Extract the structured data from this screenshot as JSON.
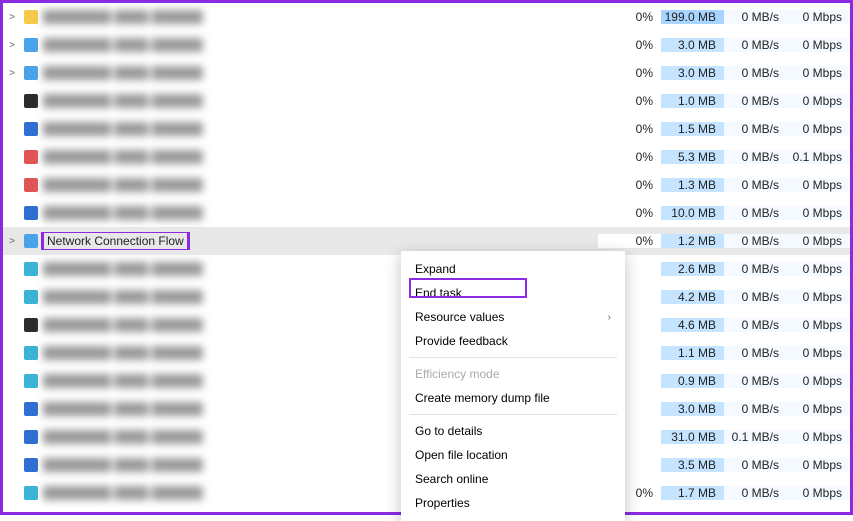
{
  "selected_process_name": "Network Connection Flow",
  "rows": [
    {
      "expand": ">",
      "icon": "yellow",
      "cpu": "0%",
      "mem": "199.0 MB",
      "disk": "0 MB/s",
      "net": "0 Mbps",
      "hot": true
    },
    {
      "expand": ">",
      "icon": "blue",
      "cpu": "0%",
      "mem": "3.0 MB",
      "disk": "0 MB/s",
      "net": "0 Mbps"
    },
    {
      "expand": ">",
      "icon": "blue",
      "cpu": "0%",
      "mem": "3.0 MB",
      "disk": "0 MB/s",
      "net": "0 Mbps"
    },
    {
      "expand": "",
      "icon": "dark",
      "cpu": "0%",
      "mem": "1.0 MB",
      "disk": "0 MB/s",
      "net": "0 Mbps"
    },
    {
      "expand": "",
      "icon": "wblue",
      "cpu": "0%",
      "mem": "1.5 MB",
      "disk": "0 MB/s",
      "net": "0 Mbps"
    },
    {
      "expand": "",
      "icon": "red",
      "cpu": "0%",
      "mem": "5.3 MB",
      "disk": "0 MB/s",
      "net": "0.1 Mbps"
    },
    {
      "expand": "",
      "icon": "red",
      "cpu": "0%",
      "mem": "1.3 MB",
      "disk": "0 MB/s",
      "net": "0 Mbps"
    },
    {
      "expand": "",
      "icon": "wblue",
      "cpu": "0%",
      "mem": "10.0 MB",
      "disk": "0 MB/s",
      "net": "0 Mbps"
    },
    {
      "expand": ">",
      "icon": "gear",
      "name_clear": true,
      "cpu": "0%",
      "mem": "1.2 MB",
      "disk": "0 MB/s",
      "net": "0 Mbps",
      "selected": true
    },
    {
      "expand": "",
      "icon": "teal",
      "mem": "2.6 MB",
      "disk": "0 MB/s",
      "net": "0 Mbps"
    },
    {
      "expand": "",
      "icon": "teal",
      "mem": "4.2 MB",
      "disk": "0 MB/s",
      "net": "0 Mbps"
    },
    {
      "expand": "",
      "icon": "dark",
      "mem": "4.6 MB",
      "disk": "0 MB/s",
      "net": "0 Mbps"
    },
    {
      "expand": "",
      "icon": "teal",
      "mem": "1.1 MB",
      "disk": "0 MB/s",
      "net": "0 Mbps"
    },
    {
      "expand": "",
      "icon": "teal",
      "mem": "0.9 MB",
      "disk": "0 MB/s",
      "net": "0 Mbps"
    },
    {
      "expand": "",
      "icon": "wblue",
      "mem": "3.0 MB",
      "disk": "0 MB/s",
      "net": "0 Mbps"
    },
    {
      "expand": "",
      "icon": "wblue",
      "mem": "31.0 MB",
      "disk": "0.1 MB/s",
      "net": "0 Mbps"
    },
    {
      "expand": "",
      "icon": "wblue",
      "mem": "3.5 MB",
      "disk": "0 MB/s",
      "net": "0 Mbps"
    },
    {
      "expand": "",
      "icon": "teal",
      "cpu": "0%",
      "mem": "1.7 MB",
      "disk": "0 MB/s",
      "net": "0 Mbps"
    }
  ],
  "context_menu": {
    "expand": "Expand",
    "end_task": "End task",
    "resource_values": "Resource values",
    "provide_feedback": "Provide feedback",
    "efficiency_mode": "Efficiency mode",
    "create_dump": "Create memory dump file",
    "go_to_details": "Go to details",
    "open_location": "Open file location",
    "search_online": "Search online",
    "properties": "Properties"
  }
}
